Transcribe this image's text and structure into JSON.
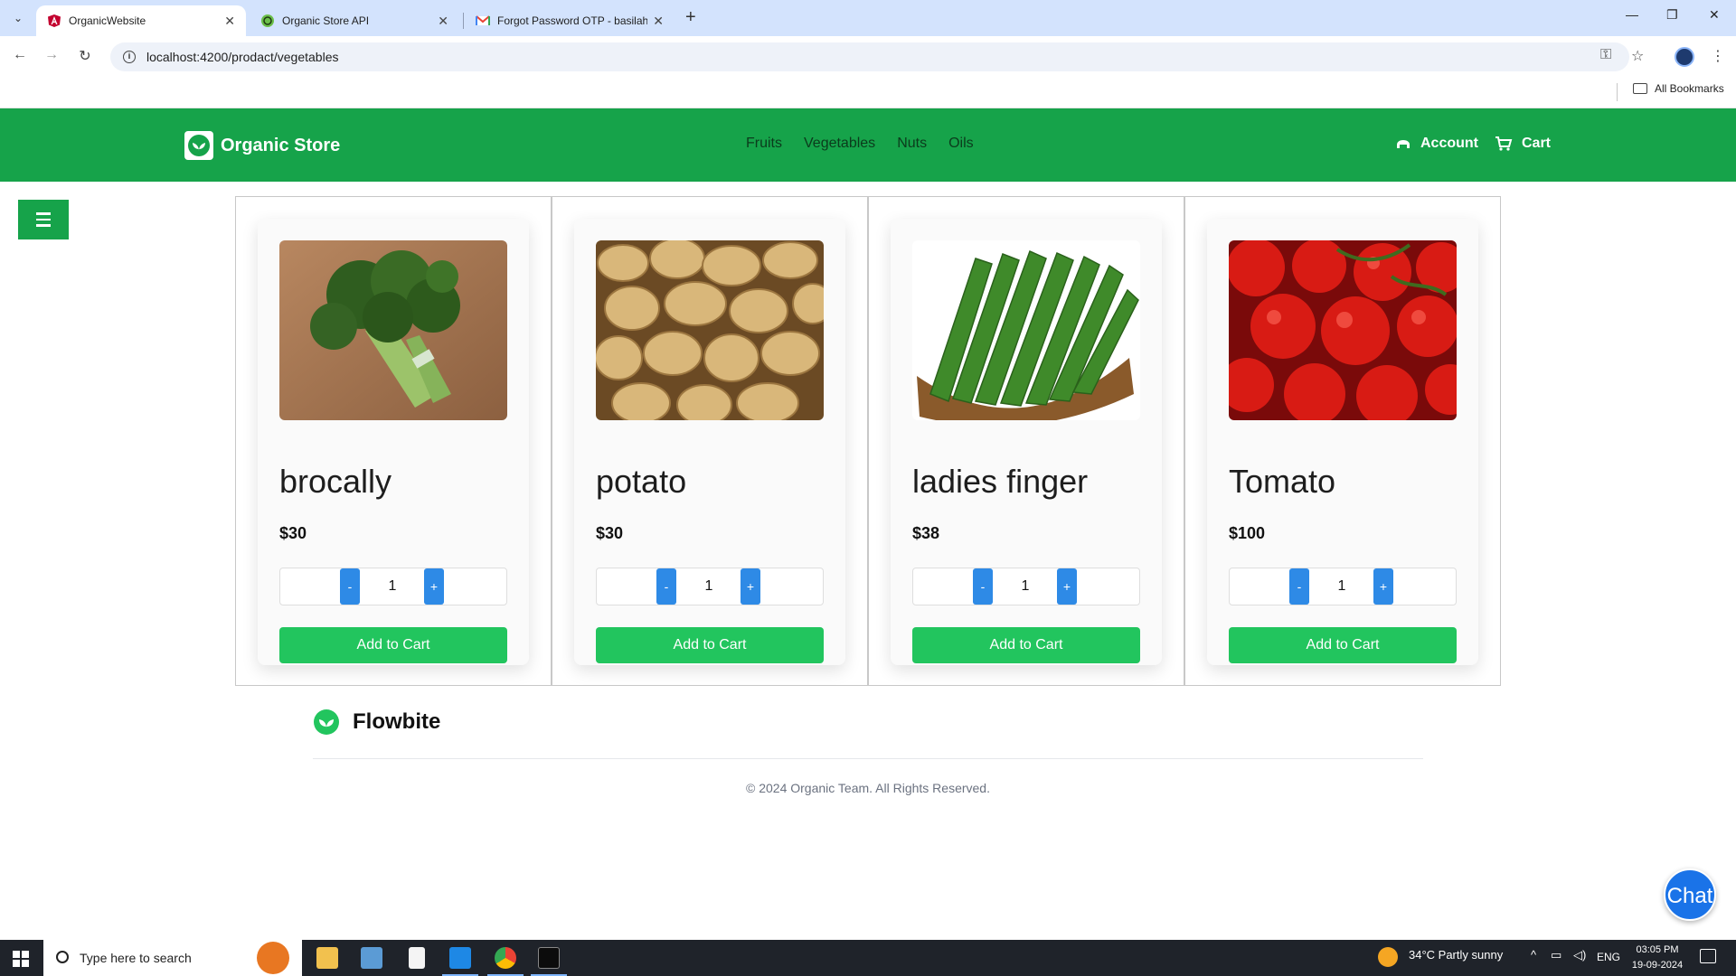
{
  "browser": {
    "tabs": [
      {
        "title": "OrganicWebsite",
        "active": true
      },
      {
        "title": "Organic Store API",
        "active": false
      },
      {
        "title": "Forgot Password OTP - basilaha",
        "active": false
      }
    ],
    "url": "localhost:4200/prodact/vegetables",
    "all_bookmarks": "All Bookmarks"
  },
  "header": {
    "brand": "Organic Store",
    "nav": [
      "Fruits",
      "Vegetables",
      "Nuts",
      "Oils"
    ],
    "account": "Account",
    "cart": "Cart",
    "brand_color": "#16a34a"
  },
  "products": [
    {
      "name": "brocally",
      "price": "$30",
      "qty": "1",
      "add_label": "Add to Cart",
      "image": "broccoli"
    },
    {
      "name": "potato",
      "price": "$30",
      "qty": "1",
      "add_label": "Add to Cart",
      "image": "potatoes"
    },
    {
      "name": "ladies finger",
      "price": "$38",
      "qty": "1",
      "add_label": "Add to Cart",
      "image": "okra"
    },
    {
      "name": "Tomato",
      "price": "$100",
      "qty": "1",
      "add_label": "Add to Cart",
      "image": "tomatoes"
    }
  ],
  "qty_controls": {
    "minus": "-",
    "plus": "+"
  },
  "footer": {
    "brand": "Flowbite",
    "copyright": "© 2024 Organic Team. All Rights Reserved."
  },
  "chat": {
    "label": "Chat"
  },
  "taskbar": {
    "search_placeholder": "Type here to search",
    "weather": "34°C  Partly sunny",
    "language": "ENG",
    "time": "03:05 PM",
    "date": "19-09-2024"
  }
}
